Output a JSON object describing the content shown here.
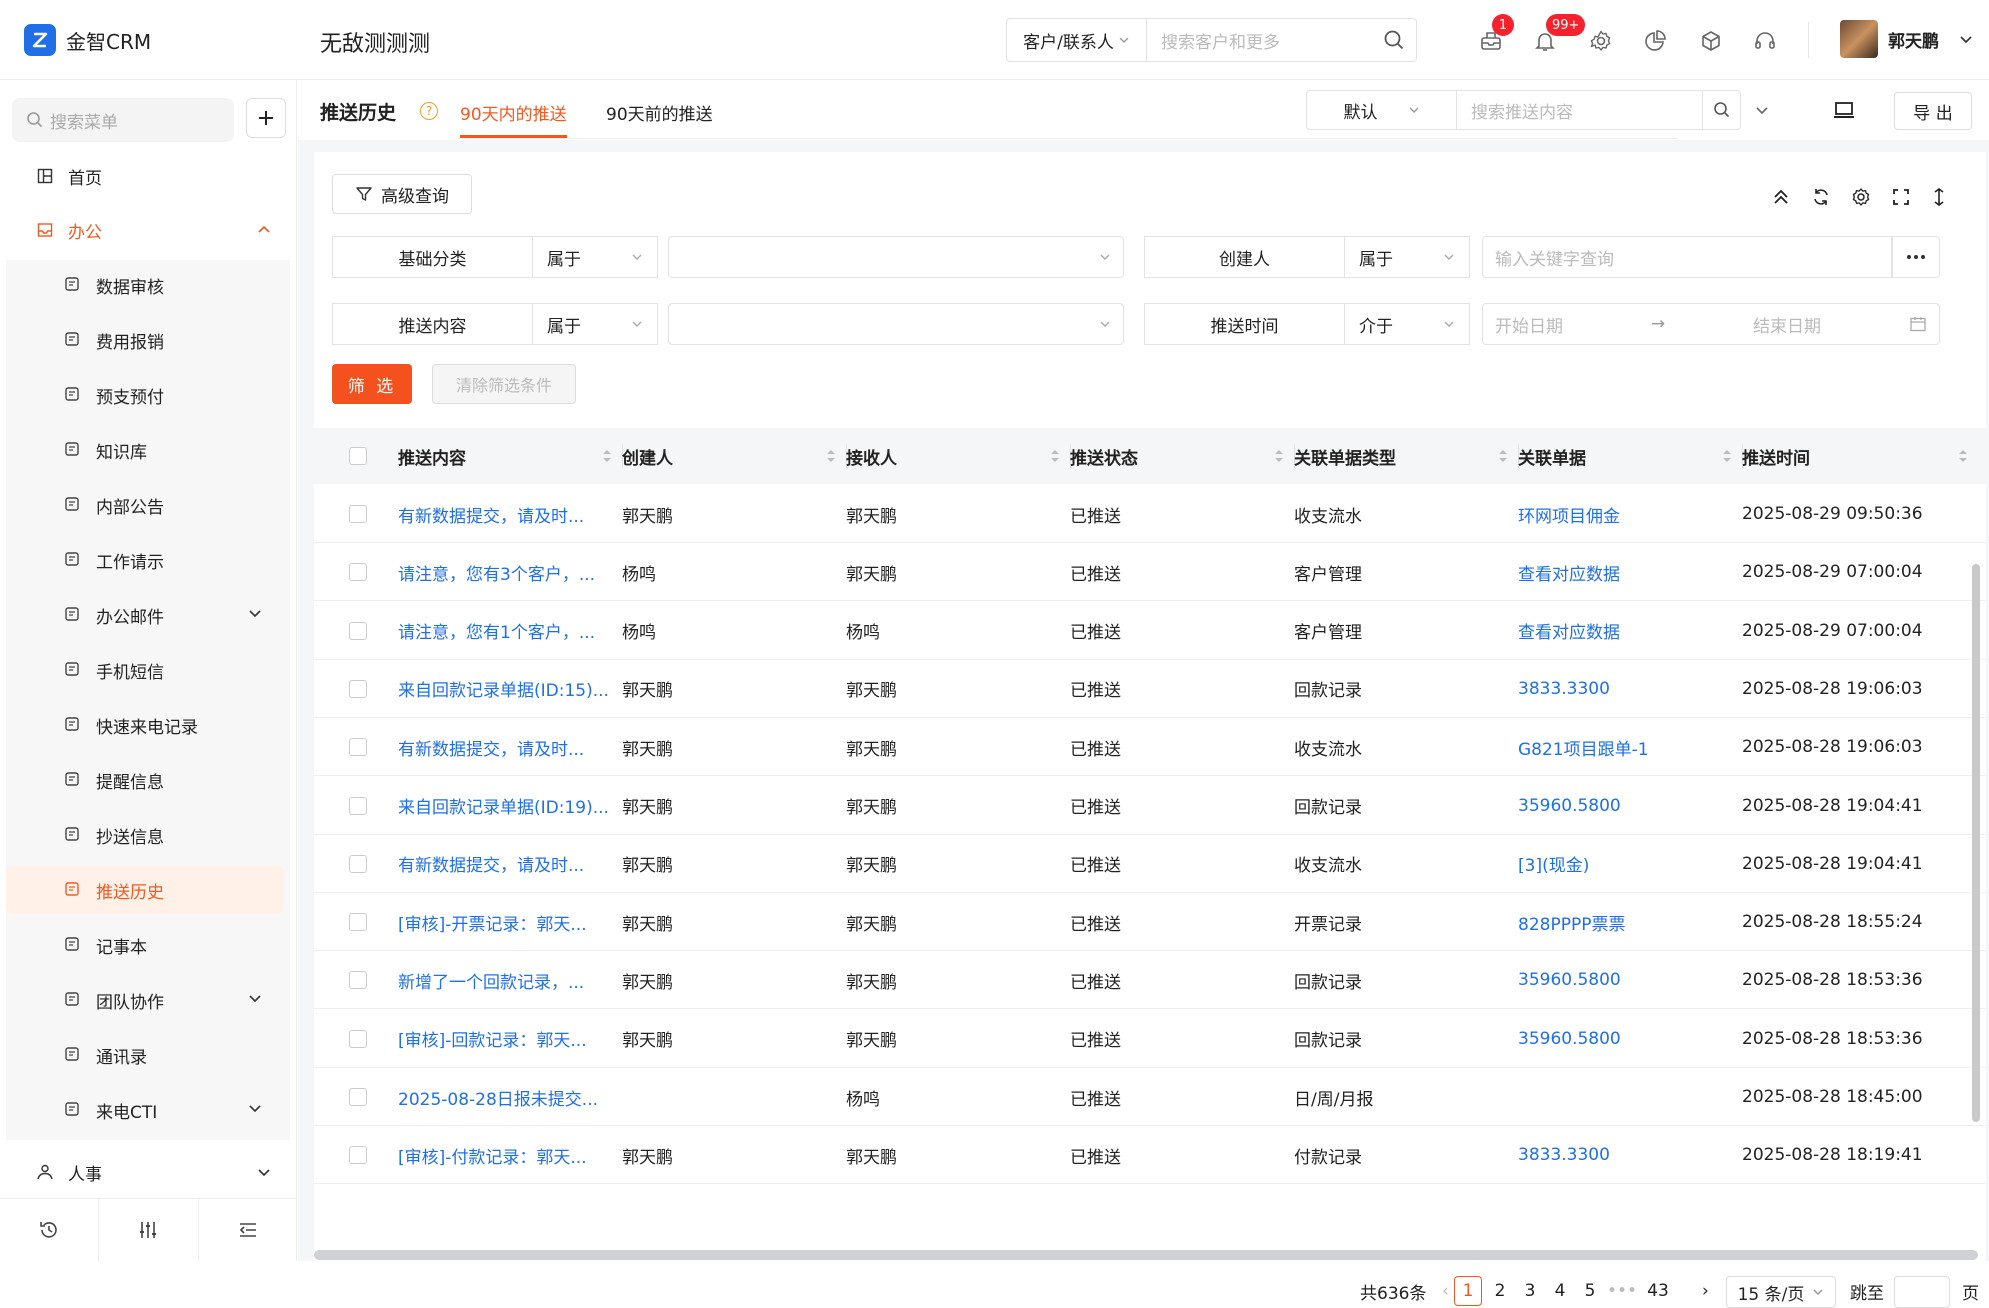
{
  "app": {
    "name": "金智CRM",
    "workspace": "无敌测测测"
  },
  "topbar": {
    "scope": "客户/联系人",
    "search_placeholder": "搜索客户和更多",
    "inbox_badge": "1",
    "notify_badge": "99+",
    "user_name": "郭天鹏"
  },
  "sidebar": {
    "search_placeholder": "搜索菜单",
    "home": "首页",
    "office": "办公",
    "sub_items": [
      {
        "label": "数据审核",
        "icon": "stamp-icon"
      },
      {
        "label": "费用报销",
        "icon": "receipt-icon"
      },
      {
        "label": "预支预付",
        "icon": "wallet-icon"
      },
      {
        "label": "知识库",
        "icon": "book-icon"
      },
      {
        "label": "内部公告",
        "icon": "megaphone-icon"
      },
      {
        "label": "工作请示",
        "icon": "report-icon"
      },
      {
        "label": "办公邮件",
        "icon": "copy-icon"
      },
      {
        "label": "手机短信",
        "icon": "chat-icon"
      },
      {
        "label": "快速来电记录",
        "icon": "note-icon"
      },
      {
        "label": "提醒信息",
        "icon": "bell-icon"
      },
      {
        "label": "抄送信息",
        "icon": "send-icon"
      },
      {
        "label": "推送历史",
        "icon": "clock-icon"
      },
      {
        "label": "记事本",
        "icon": "notebook-icon"
      },
      {
        "label": "团队协作",
        "icon": "copy-icon"
      },
      {
        "label": "通讯录",
        "icon": "contacts-icon"
      },
      {
        "label": "来电CTI",
        "icon": "copy-icon"
      }
    ],
    "hr": "人事"
  },
  "header": {
    "title": "推送历史",
    "tabs": [
      "90天内的推送",
      "90天前的推送"
    ],
    "view_select": "默认",
    "search_placeholder": "搜索推送内容",
    "export": "导 出"
  },
  "filter": {
    "advanced": "高级查询",
    "rows": [
      {
        "field": "基础分类",
        "op": "属于"
      },
      {
        "field": "创建人",
        "op": "属于",
        "placeholder": "输入关键字查询"
      },
      {
        "field": "推送内容",
        "op": "属于"
      },
      {
        "field": "推送时间",
        "op": "介于",
        "start": "开始日期",
        "end": "结束日期"
      }
    ],
    "apply": "筛 选",
    "clear": "清除筛选条件"
  },
  "table": {
    "columns": [
      "推送内容",
      "创建人",
      "接收人",
      "推送状态",
      "关联单据类型",
      "关联单据",
      "推送时间"
    ],
    "rows": [
      [
        "有新数据提交，请及时...",
        "郭天鹏",
        "郭天鹏",
        "已推送",
        "收支流水",
        "环网项目佣金",
        "2025-08-29 09:50:36"
      ],
      [
        "请注意，您有3个客户，...",
        "杨鸣",
        "郭天鹏",
        "已推送",
        "客户管理",
        "查看对应数据",
        "2025-08-29 07:00:04"
      ],
      [
        "请注意，您有1个客户，...",
        "杨鸣",
        "杨鸣",
        "已推送",
        "客户管理",
        "查看对应数据",
        "2025-08-29 07:00:04"
      ],
      [
        "来自回款记录单据(ID:15)...",
        "郭天鹏",
        "郭天鹏",
        "已推送",
        "回款记录",
        "3833.3300",
        "2025-08-28 19:06:03"
      ],
      [
        "有新数据提交，请及时...",
        "郭天鹏",
        "郭天鹏",
        "已推送",
        "收支流水",
        "G821项目跟单-1",
        "2025-08-28 19:06:03"
      ],
      [
        "来自回款记录单据(ID:19)...",
        "郭天鹏",
        "郭天鹏",
        "已推送",
        "回款记录",
        "35960.5800",
        "2025-08-28 19:04:41"
      ],
      [
        "有新数据提交，请及时...",
        "郭天鹏",
        "郭天鹏",
        "已推送",
        "收支流水",
        "[3](现金)",
        "2025-08-28 19:04:41"
      ],
      [
        "[审核]-开票记录：郭天...",
        "郭天鹏",
        "郭天鹏",
        "已推送",
        "开票记录",
        "828PPPP票票",
        "2025-08-28 18:55:24"
      ],
      [
        "新增了一个回款记录，...",
        "郭天鹏",
        "郭天鹏",
        "已推送",
        "回款记录",
        "35960.5800",
        "2025-08-28 18:53:36"
      ],
      [
        "[审核]-回款记录：郭天...",
        "郭天鹏",
        "郭天鹏",
        "已推送",
        "回款记录",
        "35960.5800",
        "2025-08-28 18:53:36"
      ],
      [
        "2025-08-28日报未提交...",
        "",
        "杨鸣",
        "已推送",
        "日/周/月报",
        "",
        "2025-08-28 18:45:00"
      ],
      [
        "[审核]-付款记录：郭天...",
        "郭天鹏",
        "郭天鹏",
        "已推送",
        "付款记录",
        "3833.3300",
        "2025-08-28 18:19:41"
      ]
    ]
  },
  "pagination": {
    "total": "共636条",
    "pages": [
      "1",
      "2",
      "3",
      "4",
      "5",
      "•••",
      "43"
    ],
    "current": "1",
    "page_size": "15 条/页",
    "jump_label": "跳至",
    "page_suffix": "页"
  },
  "colors": {
    "accent": "#f05a22",
    "link": "#1f6fe8",
    "brand": "#1f6fe8"
  }
}
